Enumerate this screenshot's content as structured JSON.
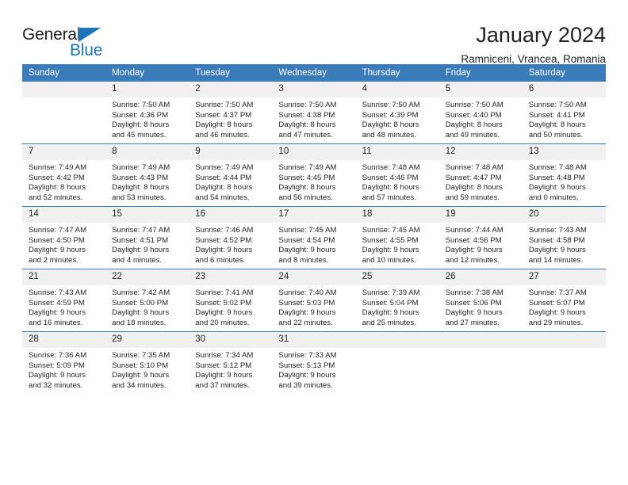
{
  "brand": {
    "name_part1": "General",
    "name_part2": "Blue",
    "accent_color": "#1b75bb"
  },
  "header": {
    "title": "January 2024",
    "subtitle": "Ramniceni, Vrancea, Romania"
  },
  "theme": {
    "header_row_bg": "#3a7cb9",
    "daynum_bg": "#f0f0f0",
    "text_color": "#231f20"
  },
  "weekday_headers": [
    "Sunday",
    "Monday",
    "Tuesday",
    "Wednesday",
    "Thursday",
    "Friday",
    "Saturday"
  ],
  "weeks": [
    [
      {
        "day": "",
        "sunrise": "",
        "sunset": "",
        "daylight_line1": "",
        "daylight_line2": ""
      },
      {
        "day": "1",
        "sunrise": "Sunrise: 7:50 AM",
        "sunset": "Sunset: 4:36 PM",
        "daylight_line1": "Daylight: 8 hours",
        "daylight_line2": "and 45 minutes."
      },
      {
        "day": "2",
        "sunrise": "Sunrise: 7:50 AM",
        "sunset": "Sunset: 4:37 PM",
        "daylight_line1": "Daylight: 8 hours",
        "daylight_line2": "and 46 minutes."
      },
      {
        "day": "3",
        "sunrise": "Sunrise: 7:50 AM",
        "sunset": "Sunset: 4:38 PM",
        "daylight_line1": "Daylight: 8 hours",
        "daylight_line2": "and 47 minutes."
      },
      {
        "day": "4",
        "sunrise": "Sunrise: 7:50 AM",
        "sunset": "Sunset: 4:39 PM",
        "daylight_line1": "Daylight: 8 hours",
        "daylight_line2": "and 48 minutes."
      },
      {
        "day": "5",
        "sunrise": "Sunrise: 7:50 AM",
        "sunset": "Sunset: 4:40 PM",
        "daylight_line1": "Daylight: 8 hours",
        "daylight_line2": "and 49 minutes."
      },
      {
        "day": "6",
        "sunrise": "Sunrise: 7:50 AM",
        "sunset": "Sunset: 4:41 PM",
        "daylight_line1": "Daylight: 8 hours",
        "daylight_line2": "and 50 minutes."
      }
    ],
    [
      {
        "day": "7",
        "sunrise": "Sunrise: 7:49 AM",
        "sunset": "Sunset: 4:42 PM",
        "daylight_line1": "Daylight: 8 hours",
        "daylight_line2": "and 52 minutes."
      },
      {
        "day": "8",
        "sunrise": "Sunrise: 7:49 AM",
        "sunset": "Sunset: 4:43 PM",
        "daylight_line1": "Daylight: 8 hours",
        "daylight_line2": "and 53 minutes."
      },
      {
        "day": "9",
        "sunrise": "Sunrise: 7:49 AM",
        "sunset": "Sunset: 4:44 PM",
        "daylight_line1": "Daylight: 8 hours",
        "daylight_line2": "and 54 minutes."
      },
      {
        "day": "10",
        "sunrise": "Sunrise: 7:49 AM",
        "sunset": "Sunset: 4:45 PM",
        "daylight_line1": "Daylight: 8 hours",
        "daylight_line2": "and 56 minutes."
      },
      {
        "day": "11",
        "sunrise": "Sunrise: 7:48 AM",
        "sunset": "Sunset: 4:46 PM",
        "daylight_line1": "Daylight: 8 hours",
        "daylight_line2": "and 57 minutes."
      },
      {
        "day": "12",
        "sunrise": "Sunrise: 7:48 AM",
        "sunset": "Sunset: 4:47 PM",
        "daylight_line1": "Daylight: 8 hours",
        "daylight_line2": "and 59 minutes."
      },
      {
        "day": "13",
        "sunrise": "Sunrise: 7:48 AM",
        "sunset": "Sunset: 4:48 PM",
        "daylight_line1": "Daylight: 9 hours",
        "daylight_line2": "and 0 minutes."
      }
    ],
    [
      {
        "day": "14",
        "sunrise": "Sunrise: 7:47 AM",
        "sunset": "Sunset: 4:50 PM",
        "daylight_line1": "Daylight: 9 hours",
        "daylight_line2": "and 2 minutes."
      },
      {
        "day": "15",
        "sunrise": "Sunrise: 7:47 AM",
        "sunset": "Sunset: 4:51 PM",
        "daylight_line1": "Daylight: 9 hours",
        "daylight_line2": "and 4 minutes."
      },
      {
        "day": "16",
        "sunrise": "Sunrise: 7:46 AM",
        "sunset": "Sunset: 4:52 PM",
        "daylight_line1": "Daylight: 9 hours",
        "daylight_line2": "and 6 minutes."
      },
      {
        "day": "17",
        "sunrise": "Sunrise: 7:45 AM",
        "sunset": "Sunset: 4:54 PM",
        "daylight_line1": "Daylight: 9 hours",
        "daylight_line2": "and 8 minutes."
      },
      {
        "day": "18",
        "sunrise": "Sunrise: 7:45 AM",
        "sunset": "Sunset: 4:55 PM",
        "daylight_line1": "Daylight: 9 hours",
        "daylight_line2": "and 10 minutes."
      },
      {
        "day": "19",
        "sunrise": "Sunrise: 7:44 AM",
        "sunset": "Sunset: 4:56 PM",
        "daylight_line1": "Daylight: 9 hours",
        "daylight_line2": "and 12 minutes."
      },
      {
        "day": "20",
        "sunrise": "Sunrise: 7:43 AM",
        "sunset": "Sunset: 4:58 PM",
        "daylight_line1": "Daylight: 9 hours",
        "daylight_line2": "and 14 minutes."
      }
    ],
    [
      {
        "day": "21",
        "sunrise": "Sunrise: 7:43 AM",
        "sunset": "Sunset: 4:59 PM",
        "daylight_line1": "Daylight: 9 hours",
        "daylight_line2": "and 16 minutes."
      },
      {
        "day": "22",
        "sunrise": "Sunrise: 7:42 AM",
        "sunset": "Sunset: 5:00 PM",
        "daylight_line1": "Daylight: 9 hours",
        "daylight_line2": "and 18 minutes."
      },
      {
        "day": "23",
        "sunrise": "Sunrise: 7:41 AM",
        "sunset": "Sunset: 5:02 PM",
        "daylight_line1": "Daylight: 9 hours",
        "daylight_line2": "and 20 minutes."
      },
      {
        "day": "24",
        "sunrise": "Sunrise: 7:40 AM",
        "sunset": "Sunset: 5:03 PM",
        "daylight_line1": "Daylight: 9 hours",
        "daylight_line2": "and 22 minutes."
      },
      {
        "day": "25",
        "sunrise": "Sunrise: 7:39 AM",
        "sunset": "Sunset: 5:04 PM",
        "daylight_line1": "Daylight: 9 hours",
        "daylight_line2": "and 25 minutes."
      },
      {
        "day": "26",
        "sunrise": "Sunrise: 7:38 AM",
        "sunset": "Sunset: 5:06 PM",
        "daylight_line1": "Daylight: 9 hours",
        "daylight_line2": "and 27 minutes."
      },
      {
        "day": "27",
        "sunrise": "Sunrise: 7:37 AM",
        "sunset": "Sunset: 5:07 PM",
        "daylight_line1": "Daylight: 9 hours",
        "daylight_line2": "and 29 minutes."
      }
    ],
    [
      {
        "day": "28",
        "sunrise": "Sunrise: 7:36 AM",
        "sunset": "Sunset: 5:09 PM",
        "daylight_line1": "Daylight: 9 hours",
        "daylight_line2": "and 32 minutes."
      },
      {
        "day": "29",
        "sunrise": "Sunrise: 7:35 AM",
        "sunset": "Sunset: 5:10 PM",
        "daylight_line1": "Daylight: 9 hours",
        "daylight_line2": "and 34 minutes."
      },
      {
        "day": "30",
        "sunrise": "Sunrise: 7:34 AM",
        "sunset": "Sunset: 5:12 PM",
        "daylight_line1": "Daylight: 9 hours",
        "daylight_line2": "and 37 minutes."
      },
      {
        "day": "31",
        "sunrise": "Sunrise: 7:33 AM",
        "sunset": "Sunset: 5:13 PM",
        "daylight_line1": "Daylight: 9 hours",
        "daylight_line2": "and 39 minutes."
      },
      {
        "day": "",
        "sunrise": "",
        "sunset": "",
        "daylight_line1": "",
        "daylight_line2": ""
      },
      {
        "day": "",
        "sunrise": "",
        "sunset": "",
        "daylight_line1": "",
        "daylight_line2": ""
      },
      {
        "day": "",
        "sunrise": "",
        "sunset": "",
        "daylight_line1": "",
        "daylight_line2": ""
      }
    ]
  ]
}
